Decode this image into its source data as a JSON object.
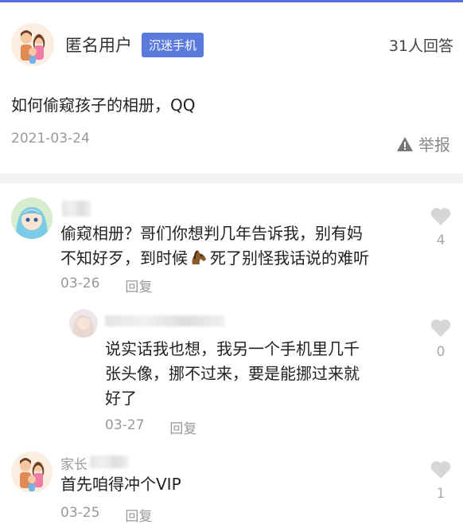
{
  "question": {
    "user_name": "匿名用户",
    "tag": "沉迷手机",
    "answer_count": "31人回答",
    "text": "如何偷窥孩子的相册，QQ",
    "date": "2021-03-24",
    "report_label": "举报"
  },
  "comments": [
    {
      "user_name": "",
      "text_line1": "偷窥相册？哥们你想判几年告诉我，别有妈",
      "text_line2a": "不知好歹，到时候",
      "text_line2b": "死了别怪我话说的难听",
      "date": "03-26",
      "reply_label": "回复",
      "likes": "4"
    },
    {
      "user_name": "",
      "text_lines": [
        "说实话我也想，我另一个手机里几千",
        "张头像，挪不过来，要是能挪过来就",
        "好了"
      ],
      "date": "03-27",
      "reply_label": "回复",
      "likes": "0"
    },
    {
      "user_name": "家长",
      "text": "首先咱得冲个VIP",
      "date": "03-25",
      "reply_label": "回复",
      "likes": "1"
    }
  ],
  "icons": {
    "report": "warning-triangle-icon",
    "like": "heart-icon",
    "emoji": "horse-emoji-icon"
  },
  "colors": {
    "accent": "#5b6ee1",
    "tag_bg": "#5b7bdc",
    "muted": "#999999"
  }
}
